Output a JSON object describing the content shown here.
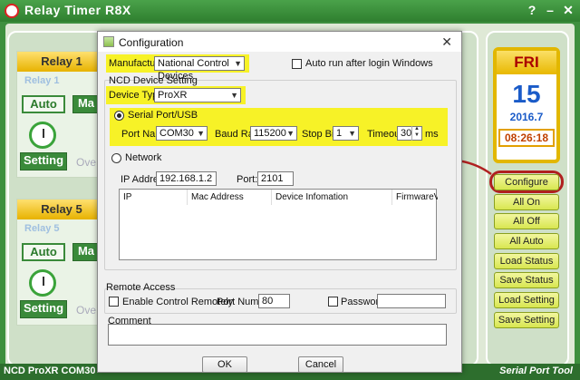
{
  "app": {
    "title": "Relay Timer R8X",
    "help_glyph": "?",
    "minimize_glyph": "–",
    "close_glyph": "✕",
    "status_left": "NCD ProXR COM30",
    "status_right": "Serial Port Tool"
  },
  "relays": [
    {
      "header": "Relay 1",
      "name": "Relay 1",
      "auto_label": "Auto",
      "mode_label": "Ma",
      "setting_label": "Setting",
      "over_label": "Ove"
    },
    {
      "header": "Relay 5",
      "name": "Relay 5",
      "auto_label": "Auto",
      "mode_label": "Ma",
      "setting_label": "Setting",
      "over_label": "Ove"
    }
  ],
  "calendar": {
    "day": "FRI",
    "date": "15",
    "year_month": "2016.7",
    "time": "08:26:18"
  },
  "sidebar_buttons": [
    "Configure",
    "All On",
    "All Off",
    "All Auto",
    "Load Status",
    "Save Status",
    "Load Setting",
    "Save Setting"
  ],
  "dialog": {
    "title": "Configuration",
    "close_glyph": "✕",
    "manufacturer_label": "Manufacturer:",
    "manufacturer_value": "National Control Devices",
    "auto_run_label": "Auto run after login Windows",
    "ncd_group_title": "NCD Device Setting",
    "device_type_label": "Device Type:",
    "device_type_value": "ProXR",
    "serial_label": "Serial Port/USB",
    "port_name_label": "Port Name:",
    "port_name_value": "COM30",
    "baud_label": "Baud Rate:",
    "baud_value": "115200",
    "stop_bits_label": "Stop Bits:",
    "stop_bits_value": "1",
    "timeout_label": "Timeout:",
    "timeout_value": "30",
    "timeout_unit": "ms",
    "network_label": "Network",
    "ip_label": "IP Address:",
    "ip_value": "192.168.1.2",
    "port_label": "Port:",
    "port_value": "2101",
    "table_headers": [
      "IP",
      "Mac Address",
      "Device Infomation",
      "FirmwareVersic"
    ],
    "remote_group_title": "Remote Access",
    "enable_remote_label": "Enable Control Remotely",
    "port_number_label": "Port Number:",
    "port_number_value": "80",
    "password_label": "Password:",
    "password_value": "",
    "comment_label": "Comment",
    "comment_value": "",
    "ok_label": "OK",
    "cancel_label": "Cancel"
  },
  "colors": {
    "highlight": "#f7f227",
    "annotation_red": "#b02020"
  }
}
